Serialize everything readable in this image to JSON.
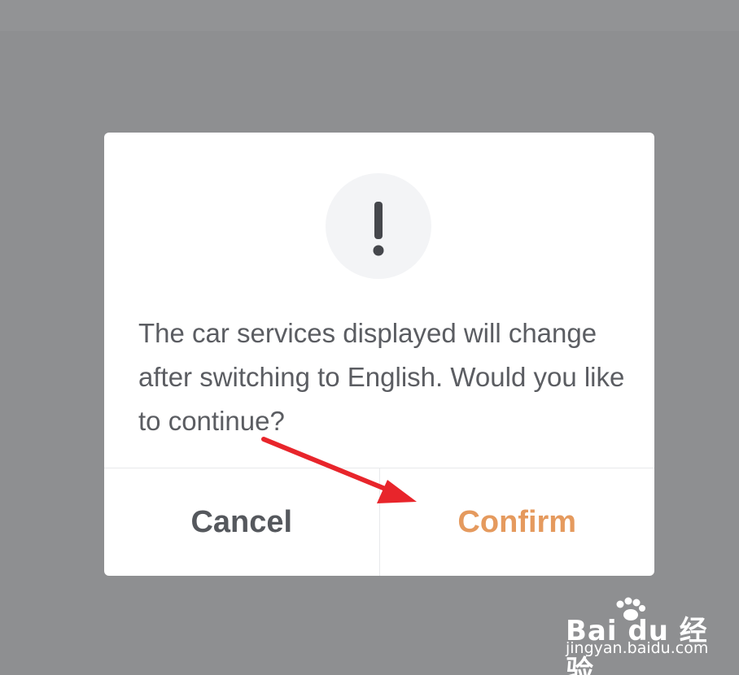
{
  "dialog": {
    "icon": "exclamation-icon",
    "message": "The car services displayed will change after switching to English. Would you like to continue?",
    "cancel_label": "Cancel",
    "confirm_label": "Confirm"
  },
  "colors": {
    "overlay": "#8e8f91",
    "dialog_bg": "#ffffff",
    "message_text": "#5b5d62",
    "cancel_text": "#55585d",
    "confirm_text": "#e59a5e",
    "annotation_arrow": "#e8252b"
  },
  "watermark": {
    "brand": "Bai du 经验",
    "url": "jingyan.baidu.com"
  }
}
